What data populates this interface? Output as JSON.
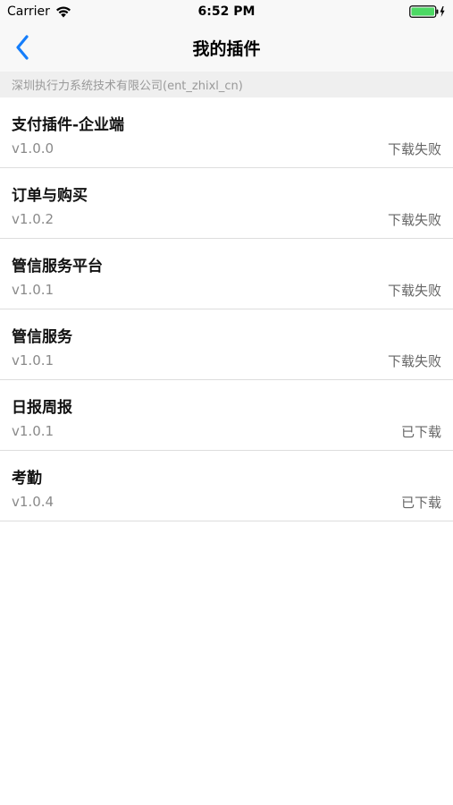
{
  "status_bar": {
    "carrier": "Carrier",
    "time": "6:52 PM",
    "wifi_icon": "wifi-icon",
    "battery_icon": "battery-charging-icon",
    "battery_color": "#4cd964"
  },
  "nav": {
    "title": "我的插件",
    "back_icon": "chevron-left-icon",
    "accent_color": "#157efb"
  },
  "company": {
    "label": "深圳执行力系统技术有限公司(ent_zhixl_cn)"
  },
  "plugins": [
    {
      "name": "支付插件-企业端",
      "version": "v1.0.0",
      "status": "下载失败"
    },
    {
      "name": "订单与购买",
      "version": "v1.0.2",
      "status": "下载失败"
    },
    {
      "name": "管信服务平台",
      "version": "v1.0.1",
      "status": "下载失败"
    },
    {
      "name": "管信服务",
      "version": "v1.0.1",
      "status": "下载失败"
    },
    {
      "name": "日报周报",
      "version": "v1.0.1",
      "status": "已下载"
    },
    {
      "name": "考勤",
      "version": "v1.0.4",
      "status": "已下载"
    }
  ]
}
